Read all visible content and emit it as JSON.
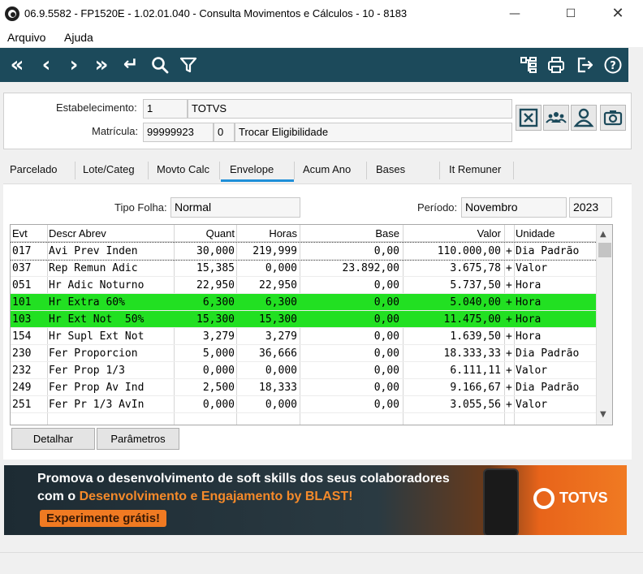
{
  "window": {
    "title": "06.9.5582 - FP1520E - 1.02.01.040 - Consulta Movimentos e Cálculos - 10 - 8183"
  },
  "menu": {
    "items": [
      "Arquivo",
      "Ajuda"
    ]
  },
  "toolbar": {
    "icons": [
      "first-icon",
      "previous-icon",
      "next-icon",
      "last-icon",
      "return-icon",
      "search-icon",
      "filter-icon",
      "tree-icon",
      "print-icon",
      "exit-icon",
      "help-icon"
    ]
  },
  "header": {
    "estabelecimento_label": "Estabelecimento:",
    "estabelecimento_code": "1",
    "estabelecimento_name": "TOTVS",
    "matricula_label": "Matrícula:",
    "matricula_value": "99999923",
    "matricula_digit": "0",
    "matricula_desc": "Trocar Eligibilidade"
  },
  "tabs": [
    "Parcelado",
    "Lote/Categ",
    "Movto Calc",
    "Envelope",
    "Acum Ano",
    "Bases",
    "It Remuner"
  ],
  "active_tab": "Envelope",
  "filters": {
    "tipo_folha_label": "Tipo Folha:",
    "tipo_folha_value": "Normal",
    "periodo_label": "Período:",
    "periodo_mes": "Novembro",
    "periodo_ano": "2023"
  },
  "grid": {
    "columns": [
      "Evt",
      "Descr Abrev",
      "Quant",
      "Horas",
      "Base",
      "Valor",
      "",
      "Unidade"
    ],
    "highlight_color": "#22e022",
    "rows": [
      {
        "evt": "017",
        "descr": "Avi Prev Inden",
        "quant": "30,000",
        "horas": "219,999",
        "base": "0,00",
        "valor": "110.000,00",
        "sinal": "+",
        "unidade": "Dia Padrão",
        "highlight": false
      },
      {
        "evt": "037",
        "descr": "Rep Remun Adic",
        "quant": "15,385",
        "horas": "0,000",
        "base": "23.892,00",
        "valor": "3.675,78",
        "sinal": "+",
        "unidade": "Valor",
        "highlight": false
      },
      {
        "evt": "051",
        "descr": "Hr Adic Noturno",
        "quant": "22,950",
        "horas": "22,950",
        "base": "0,00",
        "valor": "5.737,50",
        "sinal": "+",
        "unidade": "Hora",
        "highlight": false
      },
      {
        "evt": "101",
        "descr": "Hr Extra 60%",
        "quant": "6,300",
        "horas": "6,300",
        "base": "0,00",
        "valor": "5.040,00",
        "sinal": "+",
        "unidade": "Hora",
        "highlight": true
      },
      {
        "evt": "103",
        "descr": "Hr Ext Not  50%",
        "quant": "15,300",
        "horas": "15,300",
        "base": "0,00",
        "valor": "11.475,00",
        "sinal": "+",
        "unidade": "Hora",
        "highlight": true
      },
      {
        "evt": "154",
        "descr": "Hr Supl Ext Not",
        "quant": "3,279",
        "horas": "3,279",
        "base": "0,00",
        "valor": "1.639,50",
        "sinal": "+",
        "unidade": "Hora",
        "highlight": false
      },
      {
        "evt": "230",
        "descr": "Fer Proporcion",
        "quant": "5,000",
        "horas": "36,666",
        "base": "0,00",
        "valor": "18.333,33",
        "sinal": "+",
        "unidade": "Dia Padrão",
        "highlight": false
      },
      {
        "evt": "232",
        "descr": "Fer Prop 1/3",
        "quant": "0,000",
        "horas": "0,000",
        "base": "0,00",
        "valor": "6.111,11",
        "sinal": "+",
        "unidade": "Valor",
        "highlight": false
      },
      {
        "evt": "249",
        "descr": "Fer Prop Av Ind",
        "quant": "2,500",
        "horas": "18,333",
        "base": "0,00",
        "valor": "9.166,67",
        "sinal": "+",
        "unidade": "Dia Padrão",
        "highlight": false
      },
      {
        "evt": "251",
        "descr": "Fer Pr 1/3 AvIn",
        "quant": "0,000",
        "horas": "0,000",
        "base": "0,00",
        "valor": "3.055,56",
        "sinal": "+",
        "unidade": "Valor",
        "highlight": false
      }
    ]
  },
  "buttons": {
    "detalhar": "Detalhar",
    "parametros": "Parâmetros"
  },
  "banner": {
    "line1": "Promova o desenvolvimento de soft skills dos seus colaboradores",
    "line2_prefix": "com o ",
    "line2_highlight": "Desenvolvimento e Engajamento by BLAST!",
    "cta": "Experimente grátis!",
    "brand": "TOTVS"
  }
}
